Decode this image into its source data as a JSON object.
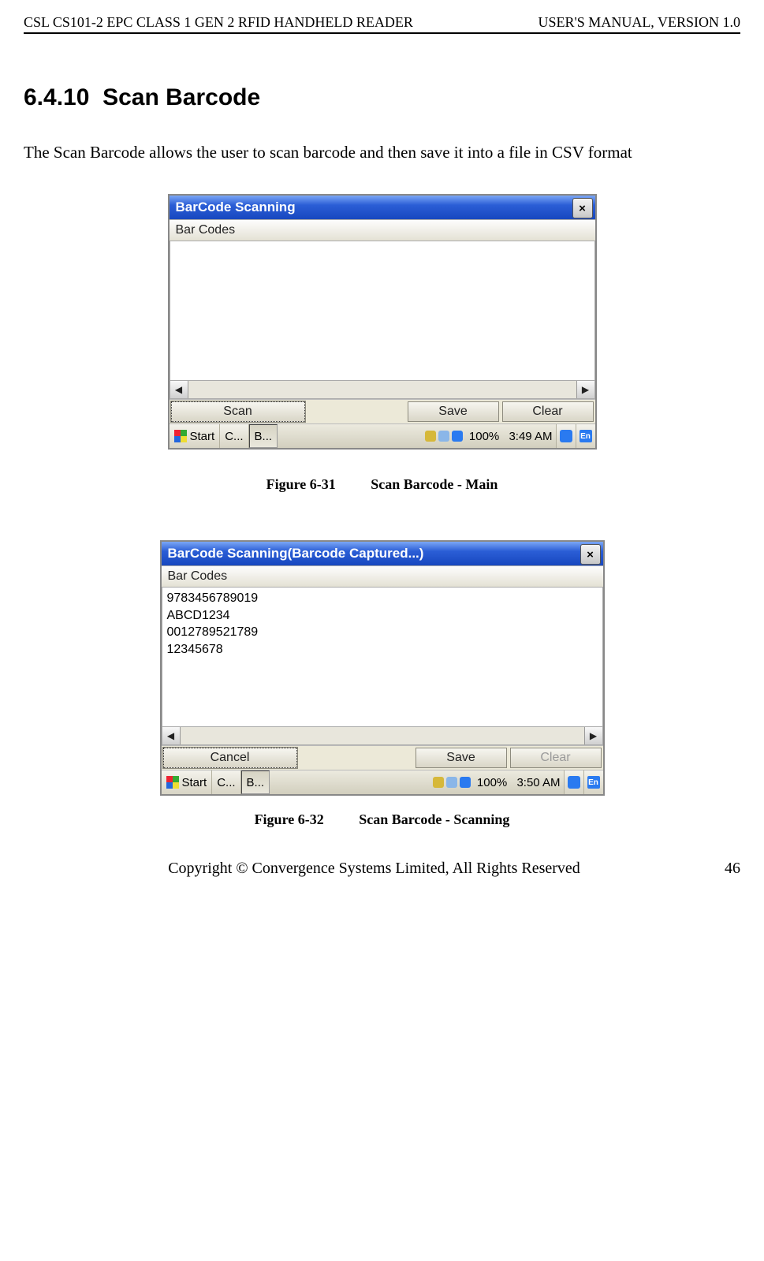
{
  "header": {
    "left": "CSL CS101-2 EPC CLASS 1 GEN 2 RFID HANDHELD READER",
    "right": "USER'S  MANUAL,  VERSION  1.0"
  },
  "section": {
    "number": "6.4.10",
    "title": "Scan Barcode"
  },
  "intro_text": "The Scan Barcode allows the user to scan barcode and then save it into a file in CSV format",
  "fig1": {
    "caption_no": "Figure 6-31",
    "caption_title": "Scan Barcode - Main",
    "window_title": "BarCode Scanning",
    "close_glyph": "×",
    "column_header": "Bar Codes",
    "rows": [],
    "scroll_left": "◀",
    "scroll_right": "▶",
    "btn_primary": "Scan",
    "btn_save": "Save",
    "btn_clear": "Clear",
    "taskbar": {
      "start": "Start",
      "tasks": [
        "C...",
        "B..."
      ],
      "battery": "100%",
      "time": "3:49 AM",
      "ime_label": "En"
    }
  },
  "fig2": {
    "caption_no": "Figure 6-32",
    "caption_title": "Scan Barcode - Scanning",
    "window_title": "BarCode Scanning(Barcode Captured...)",
    "close_glyph": "×",
    "column_header": "Bar Codes",
    "rows": [
      "9783456789019",
      "ABCD1234",
      "0012789521789",
      "12345678"
    ],
    "scroll_left": "◀",
    "scroll_right": "▶",
    "btn_primary": "Cancel",
    "btn_save": "Save",
    "btn_clear": "Clear",
    "btn_clear_disabled": true,
    "taskbar": {
      "start": "Start",
      "tasks": [
        "C...",
        "B..."
      ],
      "battery": "100%",
      "time": "3:50 AM",
      "ime_label": "En"
    }
  },
  "footer": {
    "text": "Copyright © Convergence Systems Limited, All Rights Reserved",
    "page": "46"
  }
}
